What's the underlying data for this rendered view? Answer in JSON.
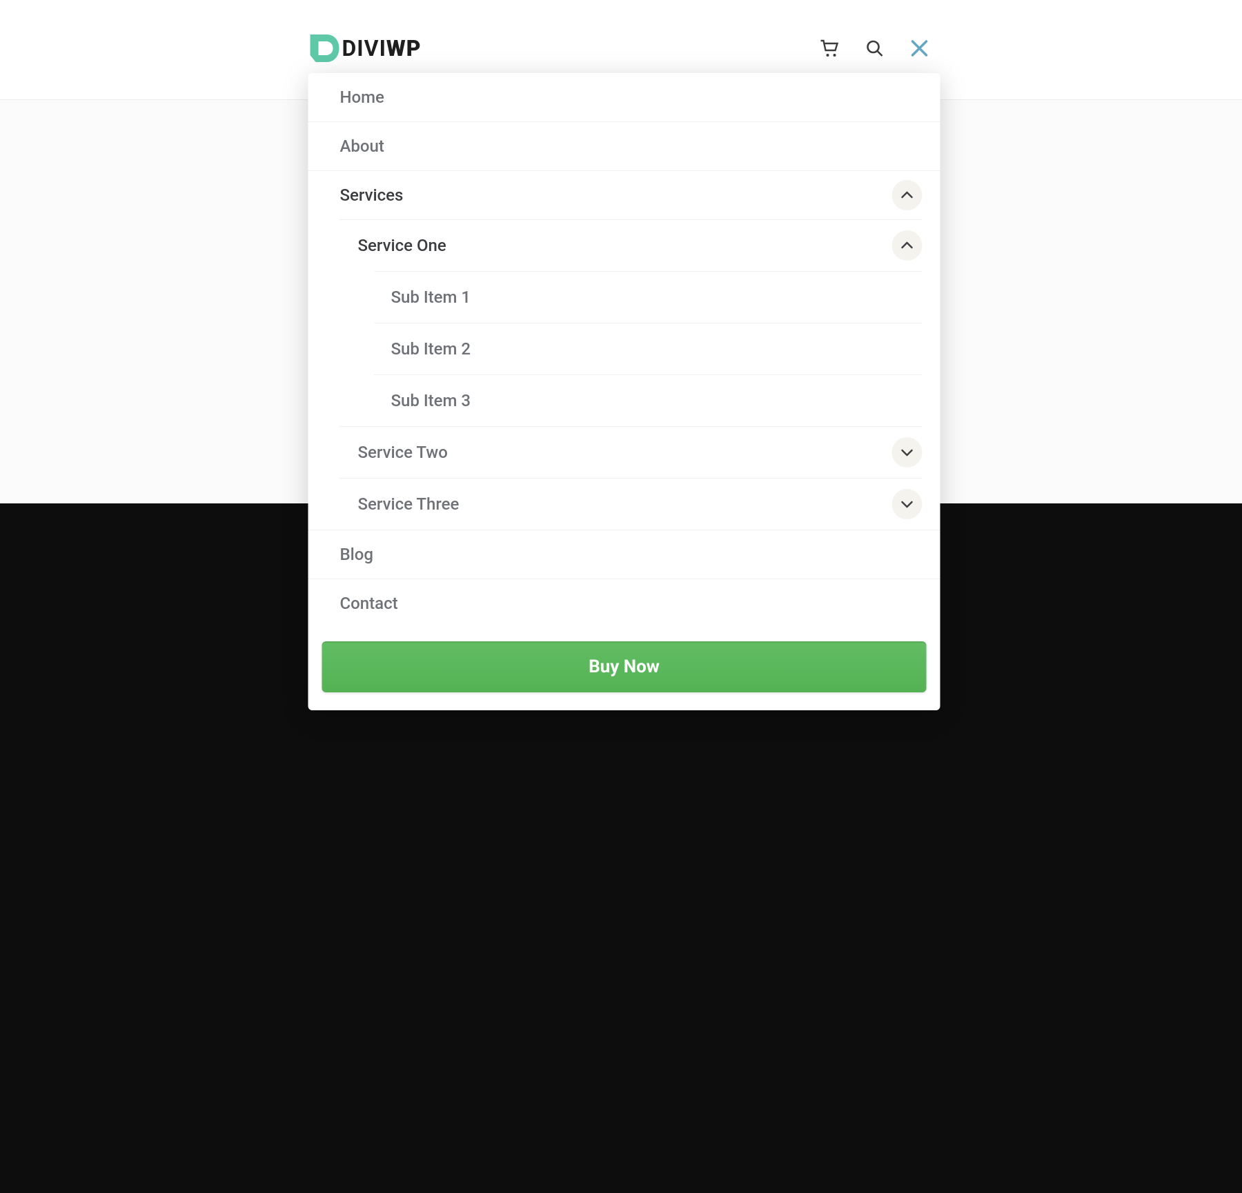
{
  "brand": {
    "name": "DIVI",
    "suffix": "WP"
  },
  "menu": {
    "items": [
      {
        "label": "Home"
      },
      {
        "label": "About"
      },
      {
        "label": "Services",
        "expanded": true,
        "children": [
          {
            "label": "Service One",
            "expanded": true,
            "children": [
              {
                "label": "Sub Item 1"
              },
              {
                "label": "Sub Item 2"
              },
              {
                "label": "Sub Item 3"
              }
            ]
          },
          {
            "label": "Service Two",
            "expanded": false
          },
          {
            "label": "Service Three",
            "expanded": false
          }
        ]
      },
      {
        "label": "Blog"
      },
      {
        "label": "Contact"
      }
    ]
  },
  "cta": {
    "buy_label": "Buy Now"
  }
}
